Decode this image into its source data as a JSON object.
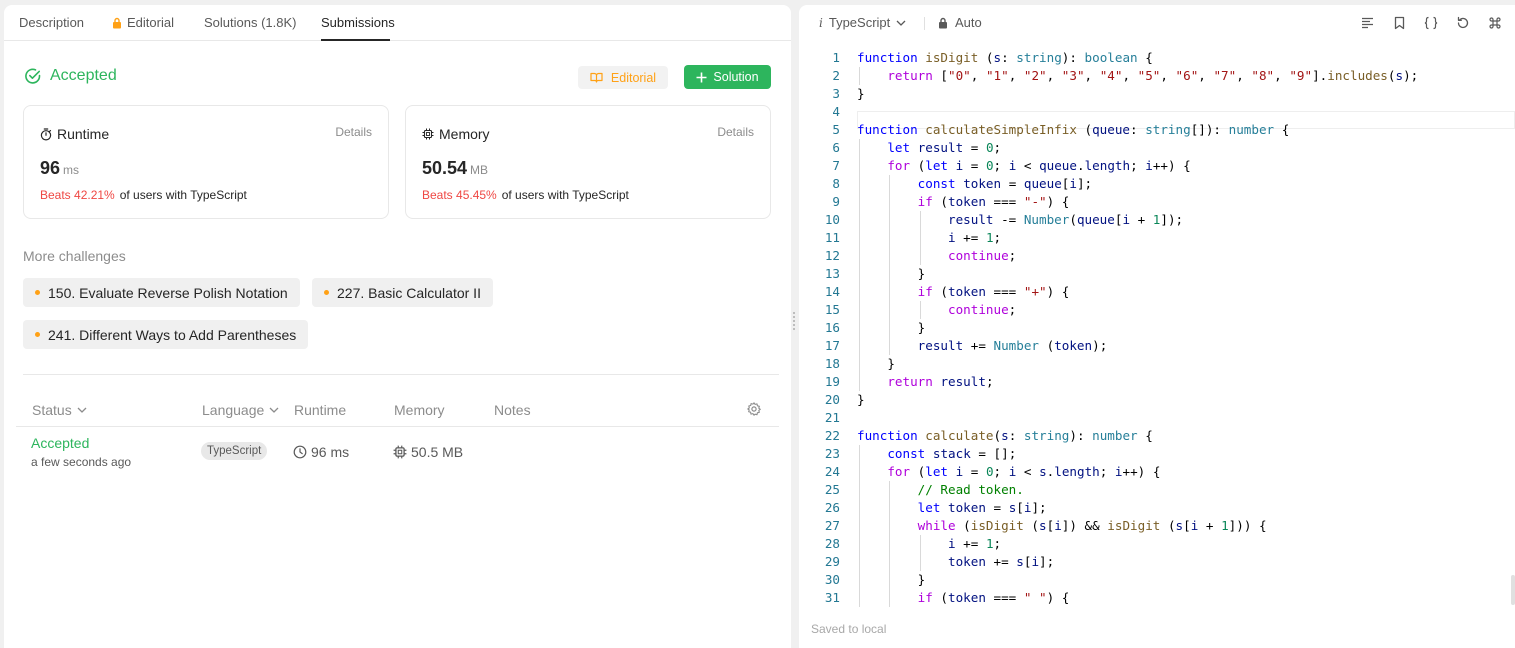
{
  "tabs": [
    {
      "label": "Description"
    },
    {
      "label": "Editorial",
      "icon": "lock-icon",
      "icon_color": "#ffa116"
    },
    {
      "label": "Solutions (1.8K)"
    },
    {
      "label": "Submissions",
      "active": true
    }
  ],
  "result": {
    "status": "Accepted",
    "status_color": "#2db55d",
    "editorial_btn": "Editorial",
    "solution_btn": "Solution"
  },
  "runtime": {
    "title": "Runtime",
    "details": "Details",
    "value": "96",
    "unit": "ms",
    "beats": "Beats 42.21%",
    "beats_rest": "of users with TypeScript"
  },
  "memory": {
    "title": "Memory",
    "details": "Details",
    "value": "50.54",
    "unit": "MB",
    "beats": "Beats 45.45%",
    "beats_rest": "of users with TypeScript"
  },
  "more_challenges": {
    "label": "More challenges",
    "items": [
      "150. Evaluate Reverse Polish Notation",
      "227. Basic Calculator II",
      "241. Different Ways to Add Parentheses"
    ]
  },
  "table": {
    "headers": [
      "Status",
      "Language",
      "Runtime",
      "Memory",
      "Notes"
    ],
    "rows": [
      {
        "status": "Accepted",
        "time": "a few seconds ago",
        "language": "TypeScript",
        "runtime": "96 ms",
        "memory": "50.5 MB"
      }
    ]
  },
  "editor": {
    "language": "TypeScript",
    "mode": "Auto",
    "saved": "Saved to local",
    "lines": [
      "function isDigit (s: string): boolean {",
      "    return [\"0\", \"1\", \"2\", \"3\", \"4\", \"5\", \"6\", \"7\", \"8\", \"9\"].includes(s);",
      "}",
      "",
      "function calculateSimpleInfix (queue: string[]): number {",
      "    let result = 0;",
      "    for (let i = 0; i < queue.length; i++) {",
      "        const token = queue[i];",
      "        if (token === \"-\") {",
      "            result -= Number(queue[i + 1]);",
      "            i += 1;",
      "            continue;",
      "        }",
      "        if (token === \"+\") {",
      "            continue;",
      "        }",
      "        result += Number (token);",
      "    }",
      "    return result;",
      "}",
      "",
      "function calculate(s: string): number {",
      "    const stack = [];",
      "    for (let i = 0; i < s.length; i++) {",
      "        // Read token.",
      "        let token = s[i];",
      "        while (isDigit (s[i]) && isDigit (s[i + 1])) {",
      "            i += 1;",
      "            token += s[i];",
      "        }",
      "        if (token === \" \") {"
    ]
  }
}
